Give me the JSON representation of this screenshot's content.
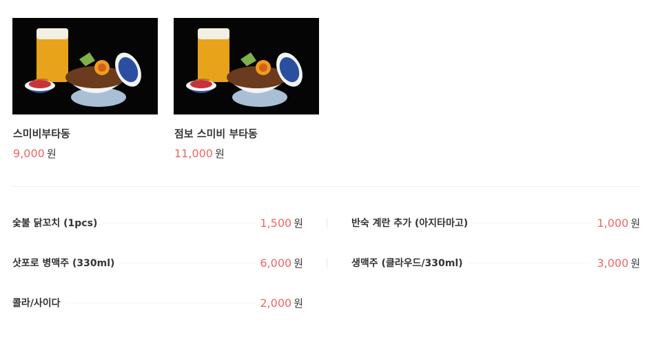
{
  "menu": [
    {
      "name": "스미비부타동",
      "price": "9,000",
      "unit": "원"
    },
    {
      "name": "점보 스미비 부타동",
      "price": "11,000",
      "unit": "원"
    }
  ],
  "options": [
    {
      "label": "숯불 닭꼬치 (1pcs)",
      "price": "1,500",
      "unit": "원"
    },
    {
      "label": "반숙 계란 추가 (아지타마고)",
      "price": "1,000",
      "unit": "원"
    },
    {
      "label": "삿포로 병맥주 (330ml)",
      "price": "6,000",
      "unit": "원"
    },
    {
      "label": "생맥주 (클라우드/330ml)",
      "price": "3,000",
      "unit": "원"
    },
    {
      "label": "콜라/사이다",
      "price": "2,000",
      "unit": "원"
    }
  ],
  "colors": {
    "price": "#f06464",
    "text": "#333333",
    "photo_bg": "#050505"
  },
  "icons": [
    "food-photo"
  ]
}
